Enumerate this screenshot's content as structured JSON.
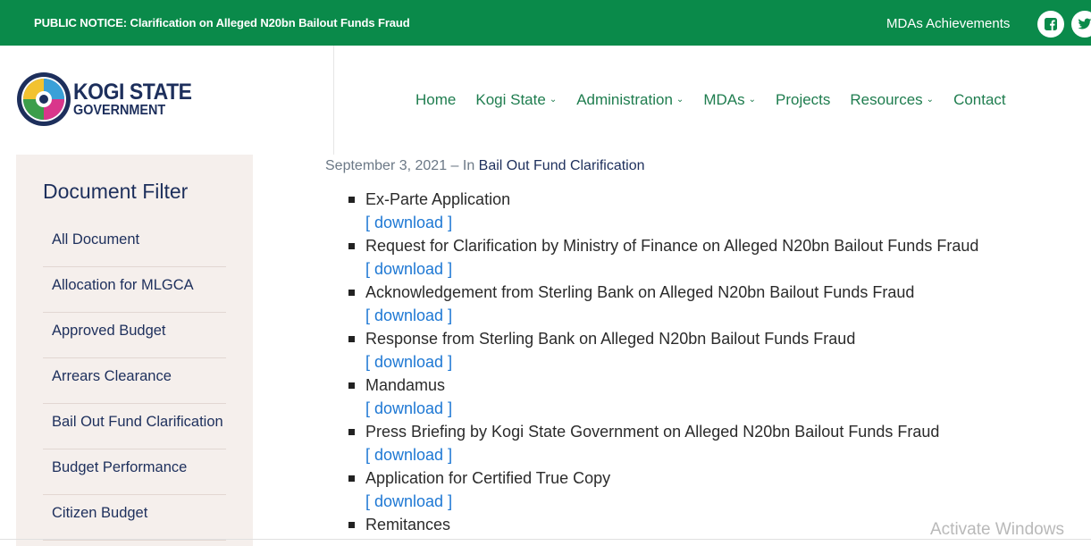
{
  "topbar": {
    "notice": "PUBLIC NOTICE: Clarification on Alleged N20bn Bailout Funds Fraud",
    "mda_link": "MDAs Achievements",
    "socials": [
      "facebook-icon",
      "twitter-icon"
    ],
    "bg_color": "#0a8a4a"
  },
  "logo": {
    "line1": "KOGI STATE",
    "line2": "GOVERNMENT"
  },
  "nav": {
    "items": [
      {
        "label": "Home"
      },
      {
        "label": "Kogi State"
      },
      {
        "label": "Administration"
      },
      {
        "label": "MDAs"
      },
      {
        "label": "Projects"
      },
      {
        "label": "Resources"
      },
      {
        "label": "Contact"
      }
    ]
  },
  "sidebar": {
    "title": "Document Filter",
    "items": [
      "All Document",
      "Allocation for MLGCA",
      "Approved Budget",
      "Arrears Clearance",
      "Bail Out Fund Clarification",
      "Budget Performance",
      "Citizen Budget"
    ]
  },
  "post": {
    "date": "September 3, 2021",
    "in_text": " – In ",
    "category": "Bail Out Fund Clarification"
  },
  "documents": [
    {
      "title": "Ex-Parte Application",
      "download": "[ download ]"
    },
    {
      "title": "Request for Clarification by Ministry of Finance on Alleged N20bn Bailout Funds Fraud",
      "download": "[ download ]"
    },
    {
      "title": "Acknowledgement from Sterling Bank on Alleged N20bn Bailout Funds Fraud",
      "download": "[ download ]"
    },
    {
      "title": "Response from Sterling Bank on Alleged N20bn Bailout Funds Fraud",
      "download": "[ download ]"
    },
    {
      "title": "Mandamus",
      "download": "[ download ]"
    },
    {
      "title": "Press Briefing by Kogi State Government on Alleged N20bn Bailout Funds Fraud",
      "download": "[ download ]"
    },
    {
      "title": "Application for Certified True Copy",
      "download": "[ download ]"
    },
    {
      "title": "Remitances",
      "download": null
    }
  ],
  "watermark": "Activate Windows"
}
